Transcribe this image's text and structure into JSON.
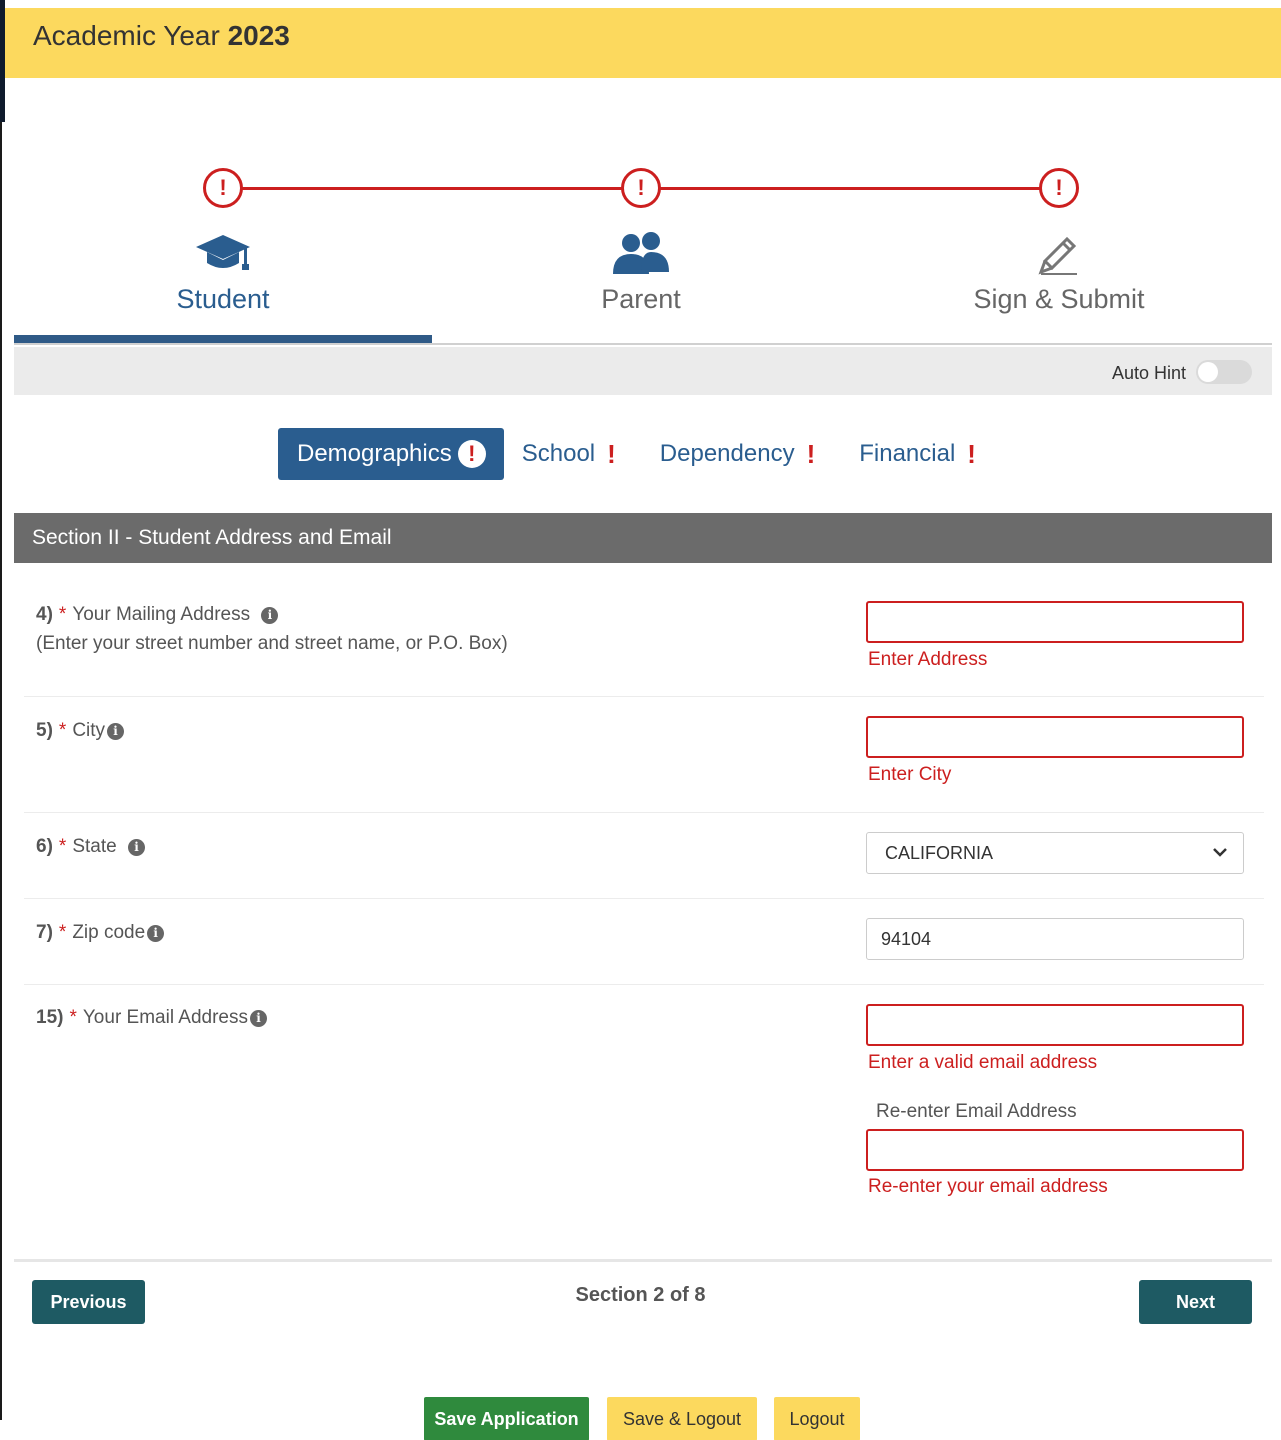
{
  "header": {
    "title_prefix": "Academic Year",
    "year": "2023"
  },
  "steps": [
    {
      "label": "Student",
      "status": "!"
    },
    {
      "label": "Parent",
      "status": "!"
    },
    {
      "label": "Sign & Submit",
      "status": "!"
    }
  ],
  "auto_hint": {
    "label": "Auto Hint",
    "enabled": false
  },
  "subtabs": [
    {
      "label": "Demographics",
      "marker": "!"
    },
    {
      "label": "School",
      "marker": "!"
    },
    {
      "label": "Dependency",
      "marker": "!"
    },
    {
      "label": "Financial",
      "marker": "!"
    }
  ],
  "section": {
    "title": "Section II - Student Address and Email"
  },
  "questions": {
    "mailing": {
      "num": "4)",
      "req": "*",
      "label": "Your Mailing Address",
      "sub": "(Enter your street number and street name, or P.O. Box)",
      "value": "",
      "error": "Enter Address"
    },
    "city": {
      "num": "5)",
      "req": "*",
      "label": "City",
      "value": "",
      "error": "Enter City"
    },
    "state": {
      "num": "6)",
      "req": "*",
      "label": "State",
      "value": "CALIFORNIA"
    },
    "zip": {
      "num": "7)",
      "req": "*",
      "label": "Zip code",
      "value": "94104"
    },
    "email": {
      "num": "15)",
      "req": "*",
      "label": "Your Email Address",
      "value": "",
      "error": "Enter a valid email address",
      "reenter_label": "Re-enter Email Address",
      "reenter_value": "",
      "reenter_error": "Re-enter your email address"
    }
  },
  "info_glyph": "i",
  "nav": {
    "previous": "Previous",
    "next": "Next",
    "progress": "Section 2 of 8"
  },
  "actions": {
    "save": "Save Application",
    "save_logout": "Save & Logout",
    "logout": "Logout"
  },
  "colors": {
    "header": "#fcd95e",
    "primary": "#2a5d8f",
    "error": "#cc1f1f",
    "nav_button": "#1e5a63",
    "save_button": "#2f8a3d",
    "section_bar": "#6b6b6b"
  }
}
